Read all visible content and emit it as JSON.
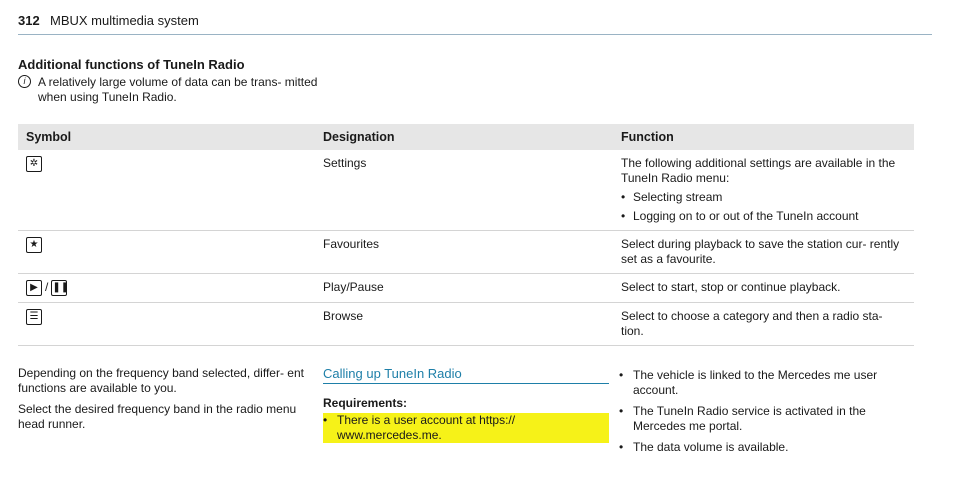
{
  "header": {
    "page_number": "312",
    "running_title": "MBUX multimedia system"
  },
  "section": {
    "title": "Additional functions of TuneIn Radio",
    "note_icon": "info-icon",
    "note": "A relatively large volume of data can be trans- mitted when using TuneIn Radio."
  },
  "table": {
    "headers": [
      "Symbol",
      "Designation",
      "Function"
    ],
    "rows": [
      {
        "icon": "settings-icon",
        "designation": "Settings",
        "function": "The following additional settings are available in the TuneIn Radio menu:",
        "bullets": [
          "Selecting stream",
          "Logging on to or out of the TuneIn account"
        ]
      },
      {
        "icon": "star-icon",
        "designation": "Favourites",
        "function": "Select during playback to save the station cur- rently set as a favourite."
      },
      {
        "icon": "play-pause-icon",
        "separator": "/",
        "designation": "Play/Pause",
        "function": "Select to start, stop or continue playback."
      },
      {
        "icon": "browse-icon",
        "designation": "Browse",
        "function": "Select to choose a category and then a radio sta- tion."
      }
    ]
  },
  "col1": {
    "p1": "Depending on the frequency band selected, differ- ent functions are available to you.",
    "p2": "Select the desired frequency band in the radio menu head runner."
  },
  "col2": {
    "heading": "Calling up TuneIn Radio",
    "req_label": "Requirements:",
    "req1": "There is a user account at https:// www.mercedes.me."
  },
  "col3": {
    "items": [
      "The vehicle is linked to the Mercedes me user account.",
      "The TuneIn Radio service is activated in the Mercedes me portal.",
      "The data volume is available."
    ]
  },
  "colors": {
    "accent": "#1e7fa8",
    "highlight": "#f6f218",
    "table_header": "#e6e6e6"
  }
}
